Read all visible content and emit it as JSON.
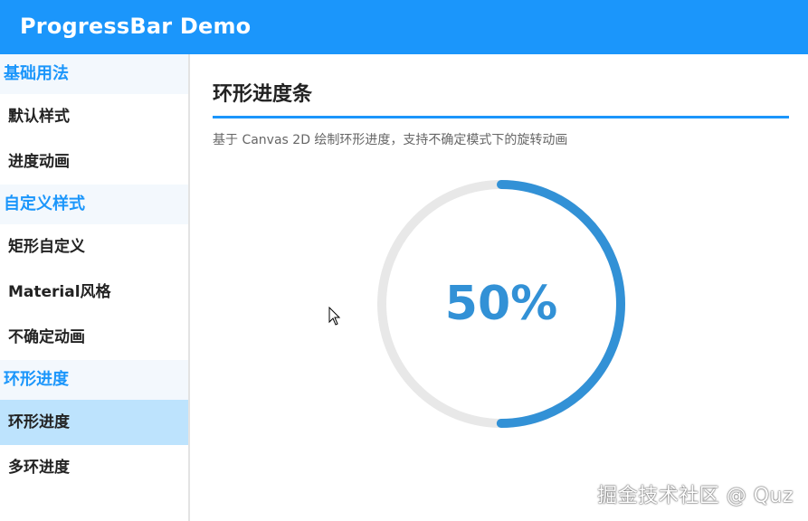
{
  "app": {
    "title": "ProgressBar Demo"
  },
  "sidebar": {
    "groups": [
      {
        "header": "基础用法",
        "items": [
          {
            "label": "默认样式"
          },
          {
            "label": "进度动画"
          }
        ]
      },
      {
        "header": "自定义样式",
        "items": [
          {
            "label": "矩形自定义"
          },
          {
            "label": "Material风格"
          },
          {
            "label": "不确定动画"
          }
        ]
      },
      {
        "header": "环形进度",
        "items": [
          {
            "label": "环形进度",
            "active": true
          },
          {
            "label": "多环进度"
          }
        ]
      }
    ]
  },
  "main": {
    "title": "环形进度条",
    "subtitle": "基于 Canvas 2D 绘制环形进度，支持不确定模式下的旋转动画",
    "ring": {
      "progress": 0.5,
      "label": "50%",
      "track_color": "#e8e8e8",
      "progress_color": "#3291d6"
    }
  },
  "watermark": "掘金技术社区 @ Quz",
  "colors": {
    "accent": "#1b96fb",
    "active_item_bg": "#bde3fd",
    "group_header_bg": "#f3f8fd"
  }
}
